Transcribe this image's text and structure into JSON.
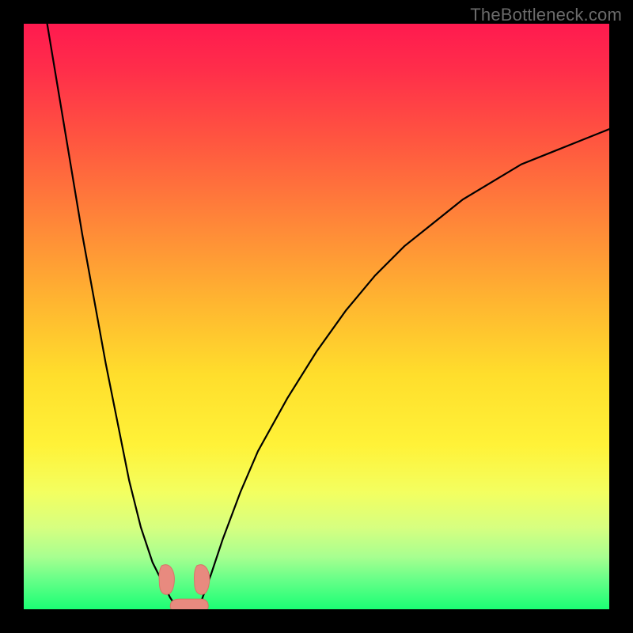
{
  "watermark": "TheBottleneck.com",
  "chart_data": {
    "type": "line",
    "title": "",
    "xlabel": "",
    "ylabel": "",
    "xlim": [
      0,
      100
    ],
    "ylim": [
      0,
      100
    ],
    "series": [
      {
        "name": "left-branch",
        "x": [
          4,
          6,
          8,
          10,
          12,
          14,
          16,
          18,
          19,
          20,
          21,
          22,
          23,
          24,
          25,
          26
        ],
        "y": [
          100,
          88,
          76,
          64,
          53,
          42,
          32,
          22,
          18,
          14,
          11,
          8,
          6,
          4,
          2,
          0.5
        ]
      },
      {
        "name": "right-branch",
        "x": [
          30,
          32,
          34,
          37,
          40,
          45,
          50,
          55,
          60,
          65,
          70,
          75,
          80,
          85,
          90,
          95,
          100
        ],
        "y": [
          0.5,
          6,
          12,
          20,
          27,
          36,
          44,
          51,
          57,
          62,
          66,
          70,
          73,
          76,
          78,
          80,
          82
        ]
      }
    ],
    "annotations": [
      {
        "name": "left_blob_at_notch",
        "x": 24.5,
        "y": 5
      },
      {
        "name": "right_blob_at_notch",
        "x": 30.5,
        "y": 5
      },
      {
        "name": "bottom_blob",
        "x": 28,
        "y": 0.8
      }
    ],
    "background_gradient": {
      "top": "#ff1a4f",
      "mid": "#ffde2c",
      "bottom": "#1bff74"
    }
  }
}
